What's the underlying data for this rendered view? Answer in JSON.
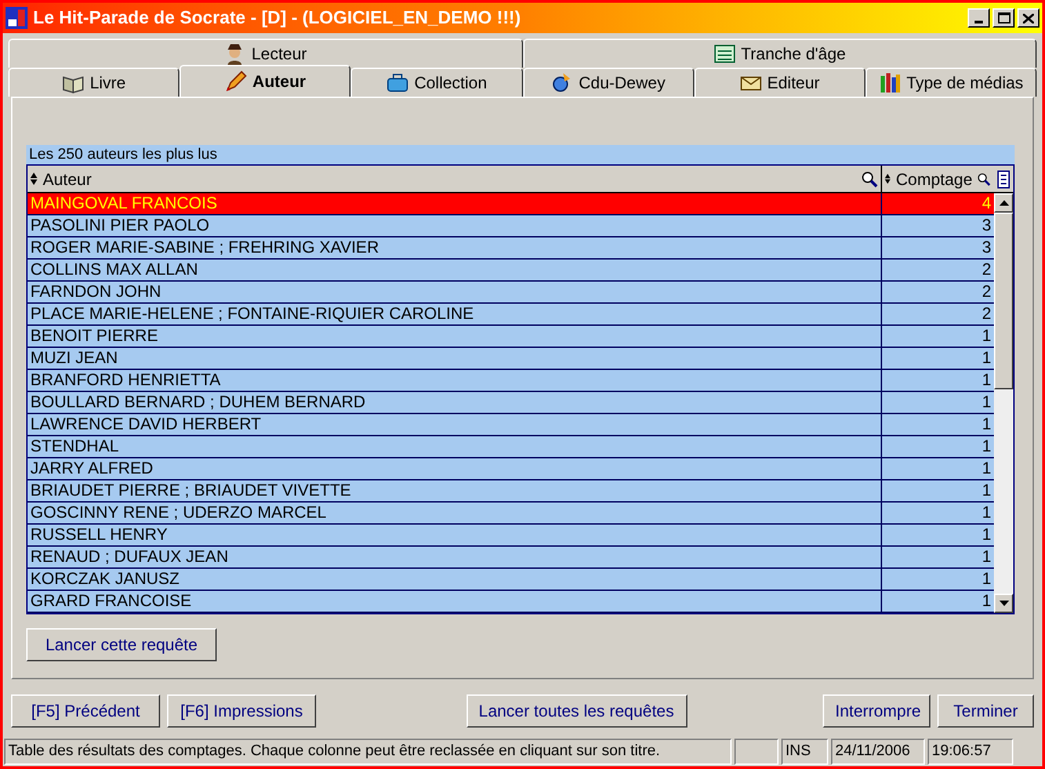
{
  "window": {
    "title": "Le Hit-Parade de Socrate - [D] - (LOGICIEL_EN_DEMO !!!)"
  },
  "tab_rows": [
    [
      {
        "label": "Lecteur",
        "selected": false
      },
      {
        "label": "Tranche d'âge",
        "selected": false
      }
    ],
    [
      {
        "label": "Livre",
        "selected": false
      },
      {
        "label": "Auteur",
        "selected": true
      },
      {
        "label": "Collection",
        "selected": false
      },
      {
        "label": "Cdu-Dewey",
        "selected": false
      },
      {
        "label": "Editeur",
        "selected": false
      },
      {
        "label": "Type de médias",
        "selected": false
      }
    ]
  ],
  "table": {
    "caption": "Les 250 auteurs les plus lus",
    "columns": [
      "Auteur",
      "Comptage"
    ],
    "rows": [
      {
        "cells": [
          "MAINGOVAL FRANCOIS",
          "4"
        ],
        "selected": true
      },
      {
        "cells": [
          "PASOLINI PIER PAOLO",
          "3"
        ],
        "selected": false
      },
      {
        "cells": [
          "ROGER MARIE-SABINE ; FREHRING XAVIER",
          "3"
        ],
        "selected": false
      },
      {
        "cells": [
          "COLLINS MAX ALLAN",
          "2"
        ],
        "selected": false
      },
      {
        "cells": [
          "FARNDON JOHN",
          "2"
        ],
        "selected": false
      },
      {
        "cells": [
          "PLACE MARIE-HELENE ; FONTAINE-RIQUIER CAROLINE",
          "2"
        ],
        "selected": false
      },
      {
        "cells": [
          "BENOIT PIERRE",
          "1"
        ],
        "selected": false
      },
      {
        "cells": [
          "MUZI JEAN",
          "1"
        ],
        "selected": false
      },
      {
        "cells": [
          "BRANFORD HENRIETTA",
          "1"
        ],
        "selected": false
      },
      {
        "cells": [
          "BOULLARD BERNARD ; DUHEM BERNARD",
          "1"
        ],
        "selected": false
      },
      {
        "cells": [
          "LAWRENCE DAVID HERBERT",
          "1"
        ],
        "selected": false
      },
      {
        "cells": [
          "STENDHAL",
          "1"
        ],
        "selected": false
      },
      {
        "cells": [
          "JARRY ALFRED",
          "1"
        ],
        "selected": false
      },
      {
        "cells": [
          "BRIAUDET PIERRE ; BRIAUDET VIVETTE",
          "1"
        ],
        "selected": false
      },
      {
        "cells": [
          "GOSCINNY RENE ; UDERZO MARCEL",
          "1"
        ],
        "selected": false
      },
      {
        "cells": [
          "RUSSELL HENRY",
          "1"
        ],
        "selected": false
      },
      {
        "cells": [
          "RENAUD ; DUFAUX JEAN",
          "1"
        ],
        "selected": false
      },
      {
        "cells": [
          "KORCZAK JANUSZ",
          "1"
        ],
        "selected": false
      },
      {
        "cells": [
          "GRARD FRANCOISE",
          "1"
        ],
        "selected": false
      }
    ]
  },
  "run_button": "Lancer cette requête",
  "buttons_left": [
    "[F5] Précédent",
    "[F6] Impressions"
  ],
  "button_center": "Lancer toutes les requêtes",
  "buttons_right": [
    "Interrompre",
    "Terminer"
  ],
  "status_bar": {
    "message": "Table des résultats des comptages. Chaque colonne peut être reclassée en cliquant sur son titre.",
    "mode": "INS",
    "date": "24/11/2006",
    "time": "19:06:57"
  }
}
